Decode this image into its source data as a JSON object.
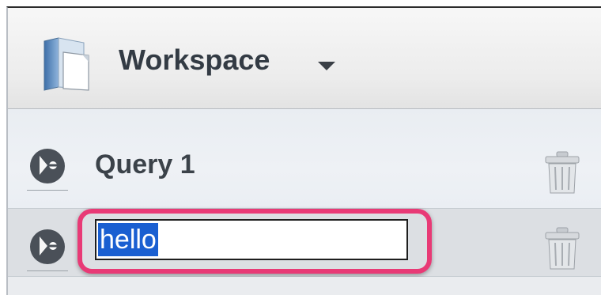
{
  "header": {
    "title": "Workspace"
  },
  "queries": [
    {
      "label": "Query 1"
    }
  ],
  "rename": {
    "value": "hello"
  },
  "colors": {
    "highlight": "#e83a76",
    "selection": "#1a5fd1",
    "row_selected": "#dcdfe3"
  },
  "icons": {
    "workspace": "workspace-book-icon",
    "query": "query-icon",
    "delete": "trash-icon",
    "dropdown": "chevron-down-icon"
  }
}
